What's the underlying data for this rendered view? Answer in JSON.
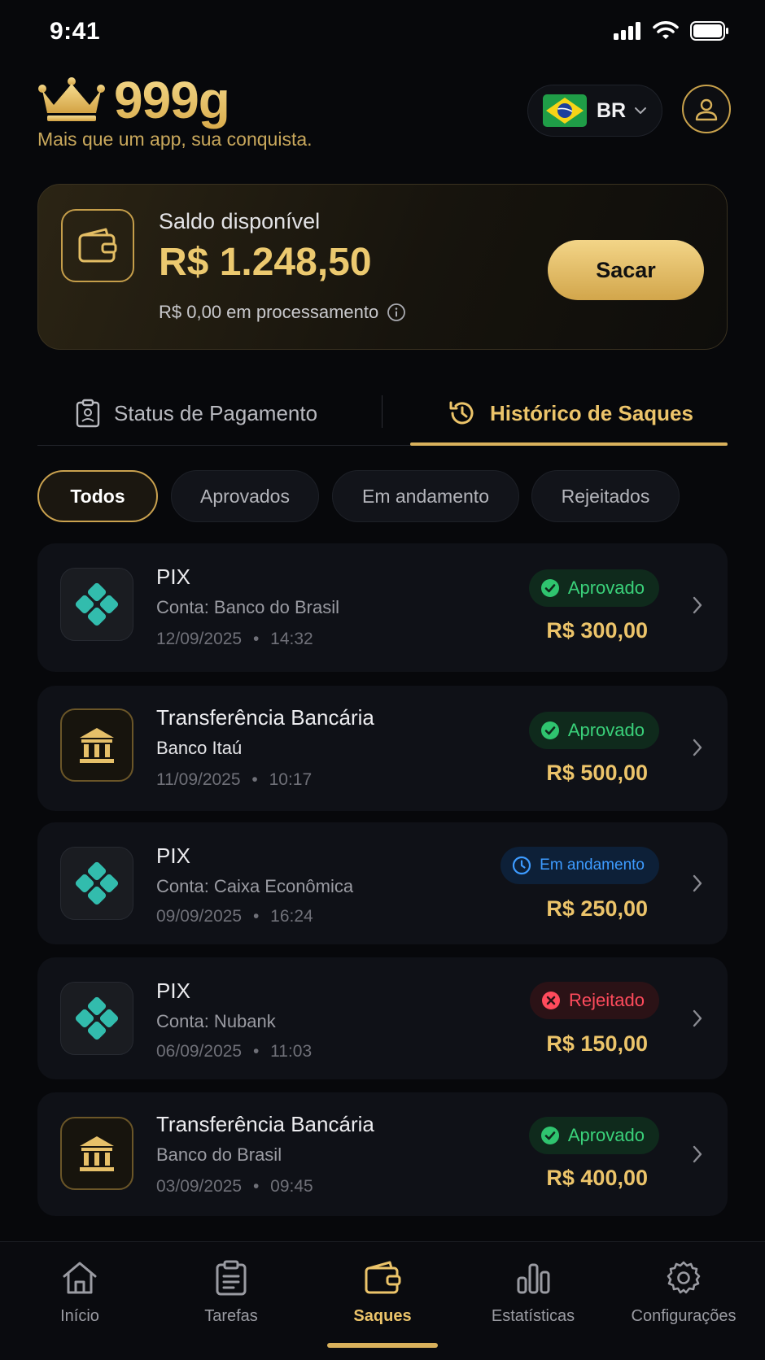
{
  "status_bar": {
    "time": "9:41"
  },
  "header": {
    "brand": "999g",
    "tagline": "Mais que um app, sua conquista.",
    "language": {
      "code": "BR"
    }
  },
  "balance": {
    "label": "Saldo disponível",
    "amount": "R$ 1.248,50",
    "processing": "R$ 0,00 em processamento",
    "withdraw_label": "Sacar"
  },
  "tabs": [
    {
      "label": "Status de Pagamento",
      "active": false
    },
    {
      "label": "Histórico de Saques",
      "active": true
    }
  ],
  "filters": [
    {
      "label": "Todos",
      "active": true
    },
    {
      "label": "Aprovados",
      "active": false
    },
    {
      "label": "Em andamento",
      "active": false
    },
    {
      "label": "Rejeitados",
      "active": false
    }
  ],
  "withdrawals": [
    {
      "method": "PIX",
      "icon": "pix-icon",
      "account": "Conta: Banco do Brasil",
      "date": "12/09/2025",
      "time": "14:32",
      "status": "Aprovado",
      "status_type": "approved",
      "amount": "R$ 300,00"
    },
    {
      "method": "Transferência Bancária",
      "icon": "bank-icon",
      "account": "Banco Itaú",
      "date": "11/09/2025",
      "time": "10:17",
      "status": "Aprovado",
      "status_type": "approved",
      "amount": "R$ 500,00"
    },
    {
      "method": "PIX",
      "icon": "pix-icon",
      "account": "Conta: Caixa Econômica",
      "date": "09/09/2025",
      "time": "16:24",
      "status": "Em andamento",
      "status_type": "pending",
      "amount": "R$ 250,00"
    },
    {
      "method": "PIX",
      "icon": "pix-icon",
      "account": "Conta: Nubank",
      "date": "06/09/2025",
      "time": "11:03",
      "status": "Rejeitado",
      "status_type": "rejected",
      "amount": "R$ 150,00"
    },
    {
      "method": "Transferência Bancária",
      "icon": "bank-icon",
      "account": "Banco do Brasil",
      "date": "03/09/2025",
      "time": "09:45",
      "status": "Aprovado",
      "status_type": "approved",
      "amount": "R$ 400,00"
    }
  ],
  "bottom_nav": [
    {
      "label": "Início",
      "icon": "home-icon",
      "active": false
    },
    {
      "label": "Tarefas",
      "icon": "clipboard-icon",
      "active": false
    },
    {
      "label": "Saques",
      "icon": "wallet-icon",
      "active": true
    },
    {
      "label": "Estatísticas",
      "icon": "bar-chart-icon",
      "active": false
    },
    {
      "label": "Configurações",
      "icon": "gear-icon",
      "active": false
    }
  ],
  "colors": {
    "background": "#07080b",
    "gold": "#e5c063",
    "approved": "#3ad17a",
    "pending": "#3d9bff",
    "rejected": "#ff4b5c",
    "pix": "#32bcad"
  }
}
